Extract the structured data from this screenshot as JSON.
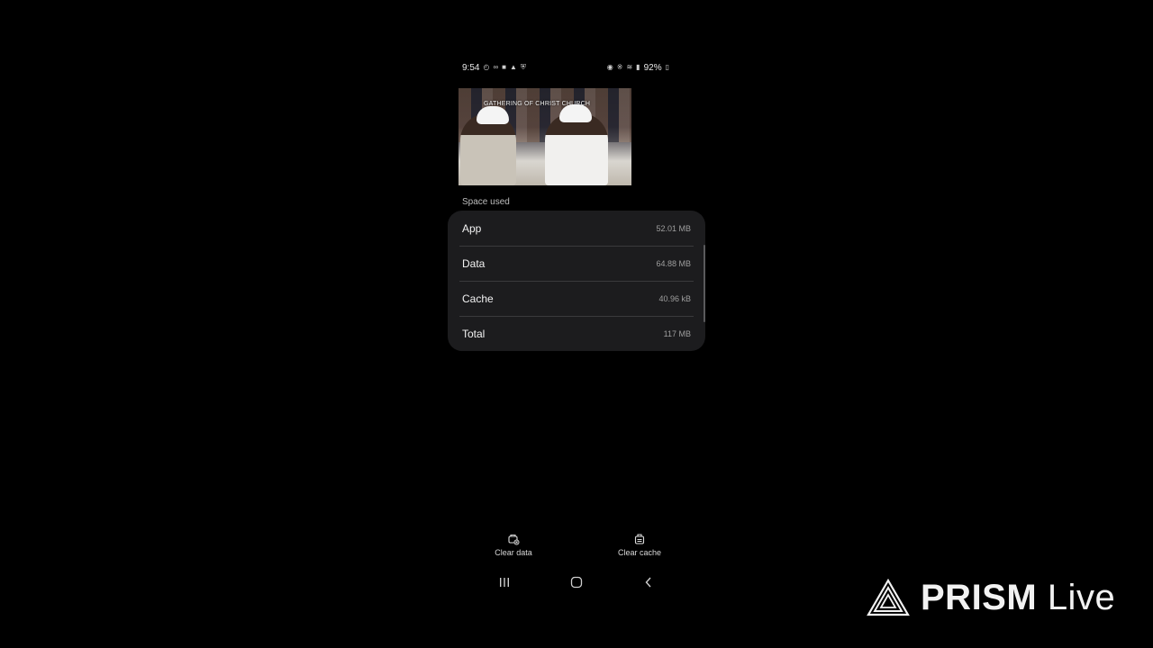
{
  "status_bar": {
    "time": "9:54",
    "battery": "92%",
    "left_icons": [
      "alarm-icon",
      "voicemail-icon",
      "folder-icon",
      "notification-icon",
      "shield-icon"
    ],
    "right_icons": [
      "nfc-icon",
      "bluetooth-icon",
      "wifi-icon",
      "signal-icon",
      "battery-icon"
    ]
  },
  "video_thumbnail": {
    "banner_text": "GATHERING OF CHRIST CHURCH"
  },
  "storage": {
    "section_label": "Space used",
    "rows": [
      {
        "label": "App",
        "value": "52.01 MB"
      },
      {
        "label": "Data",
        "value": "64.88 MB"
      },
      {
        "label": "Cache",
        "value": "40.96 kB"
      },
      {
        "label": "Total",
        "value": "117 MB"
      }
    ]
  },
  "actions": {
    "clear_data": "Clear data",
    "clear_cache": "Clear cache"
  },
  "watermark": {
    "brand": "PRISM",
    "suffix": "Live"
  },
  "colors": {
    "background": "#000000",
    "card": "#1c1c1e",
    "divider": "#3a3a3c",
    "text_primary": "#f2f2f2",
    "text_secondary": "#9e9e9e"
  }
}
